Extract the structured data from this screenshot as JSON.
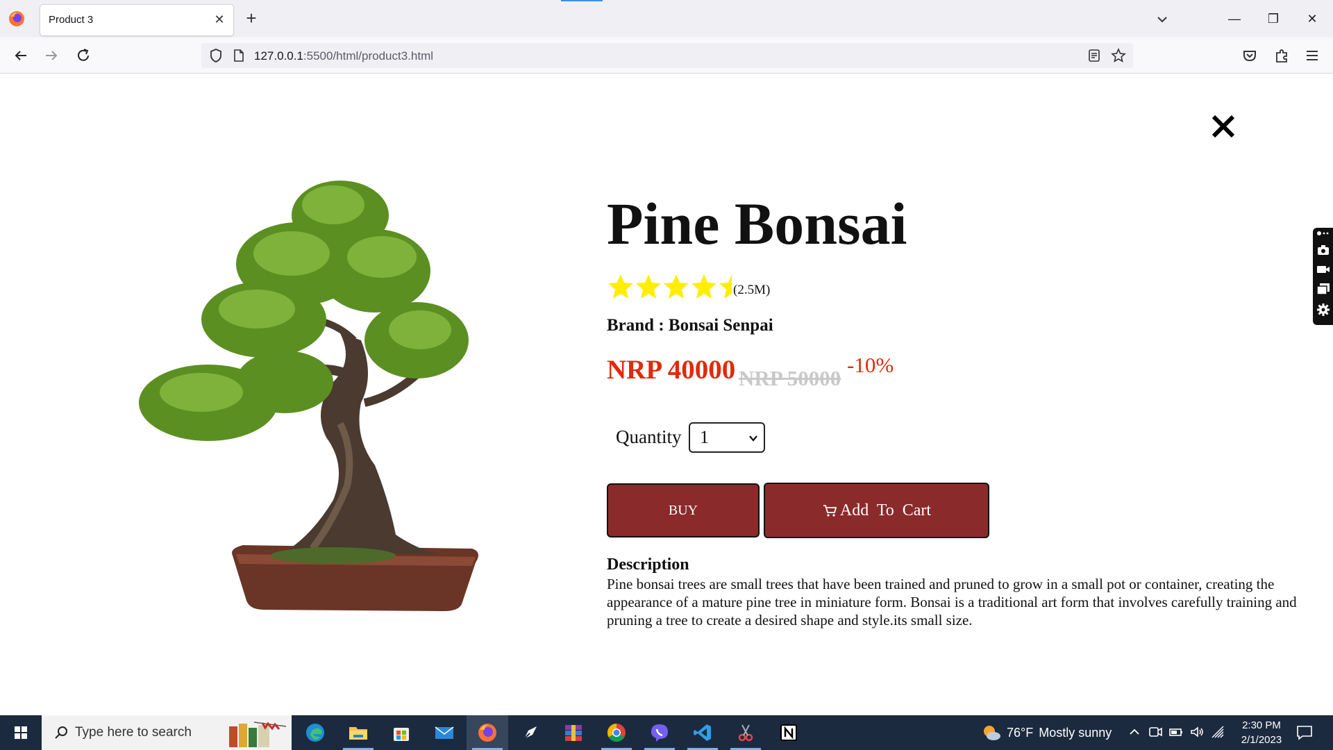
{
  "browser": {
    "tab_title": "Product 3",
    "url_host": "127.0.0.1",
    "url_path": ":5500/html/product3.html"
  },
  "product": {
    "name": "Pine Bonsai",
    "rating": 4.5,
    "rating_max": 5,
    "rating_count": "(2.5M)",
    "brand": "Brand : Bonsai Senpai",
    "price": "NRP 40000",
    "old_price": "NRP 50000",
    "discount": "-10%",
    "quantity_label": "Quantity",
    "quantity_value": "1",
    "buy_label": "BUY",
    "cart_label": "Add  To  Cart",
    "description_title": "Description",
    "description": "Pine bonsai trees are small trees that have been trained and pruned to grow in a small pot or container, creating the appearance of a mature pine tree in miniature form. Bonsai is a traditional art form that involves carefully training and pruning a tree to create a desired shape and style.its small size."
  },
  "colors": {
    "accent_red": "#e02a0a",
    "button_bg": "#8b2a2a",
    "star": "#ffee00"
  },
  "taskbar": {
    "search_placeholder": "Type here to search",
    "temperature": "76°F",
    "weather": "Mostly sunny",
    "time": "2:30 PM",
    "date": "2/1/2023"
  }
}
